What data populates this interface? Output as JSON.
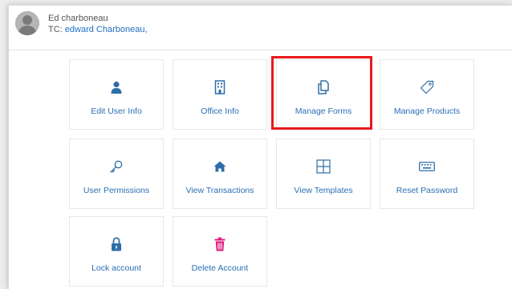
{
  "header": {
    "user_name": "Ed charboneau",
    "tc_prefix": "TC: ",
    "tc_link": "edward Charboneau,"
  },
  "tiles": [
    {
      "label": "Edit User Info",
      "icon": "user-icon",
      "color": "#2e6ea8"
    },
    {
      "label": "Office Info",
      "icon": "building-icon",
      "color": "#2e6ea8"
    },
    {
      "label": "Manage Forms",
      "icon": "copy-icon",
      "color": "#2e6ea8"
    },
    {
      "label": "Manage Products",
      "icon": "tag-icon",
      "color": "#2e6ea8"
    },
    {
      "label": "User Permissions",
      "icon": "key-icon",
      "color": "#2e6ea8"
    },
    {
      "label": "View Transactions",
      "icon": "home-icon",
      "color": "#2e6ea8"
    },
    {
      "label": "View Templates",
      "icon": "layout-icon",
      "color": "#2e6ea8"
    },
    {
      "label": "Reset Password",
      "icon": "keyboard-icon",
      "color": "#2e6ea8"
    },
    {
      "label": "Lock account",
      "icon": "lock-icon",
      "color": "#2e6ea8"
    },
    {
      "label": "Delete Account",
      "icon": "trash-icon",
      "color": "#e0197d"
    }
  ],
  "highlight": {
    "target": "Manage Forms",
    "color": "#e8191b"
  }
}
